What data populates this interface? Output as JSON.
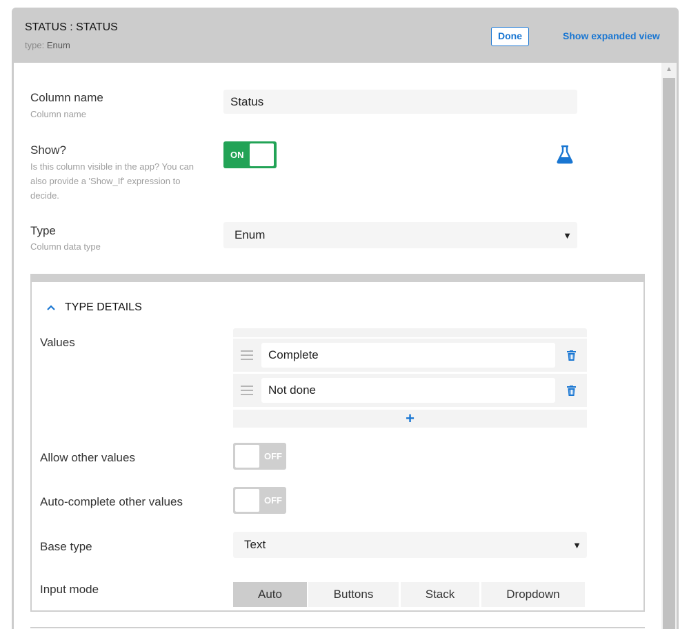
{
  "header": {
    "title": "STATUS : STATUS",
    "type_key": "type:",
    "type_value": "Enum",
    "done_label": "Done",
    "expand_label": "Show expanded view"
  },
  "fields": {
    "column_name": {
      "label": "Column name",
      "help": "Column name",
      "value": "Status"
    },
    "show": {
      "label": "Show?",
      "help": "Is this column visible in the app? You can also provide a 'Show_If' expression to decide.",
      "toggle": "ON",
      "icon": "flask-icon"
    },
    "type": {
      "label": "Type",
      "help": "Column data type",
      "value": "Enum"
    }
  },
  "type_details": {
    "title": "TYPE DETAILS",
    "values_label": "Values",
    "values": [
      "Complete",
      "Not done"
    ],
    "add_symbol": "+",
    "allow_other": {
      "label": "Allow other values",
      "toggle": "OFF"
    },
    "autocomplete": {
      "label": "Auto-complete other values",
      "toggle": "OFF"
    },
    "base_type": {
      "label": "Base type",
      "value": "Text"
    },
    "input_mode": {
      "label": "Input mode",
      "options": [
        "Auto",
        "Buttons",
        "Stack",
        "Dropdown"
      ],
      "selected": "Auto"
    }
  },
  "colors": {
    "accent": "#1976d2",
    "on_green": "#22a356",
    "header_gray": "#cccccc"
  }
}
